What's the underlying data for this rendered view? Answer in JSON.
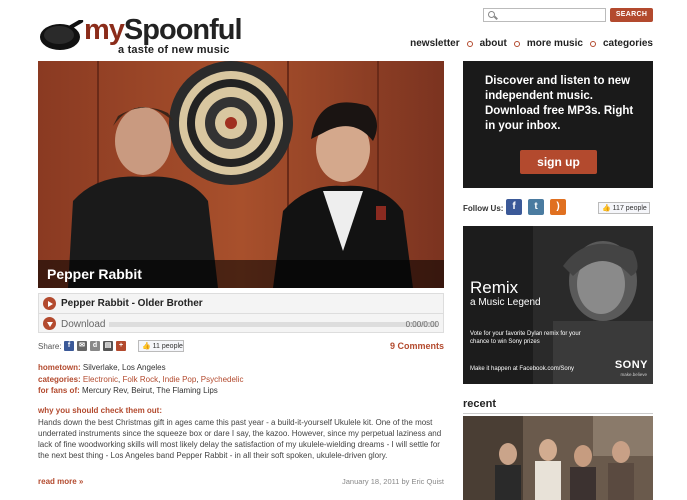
{
  "brand": {
    "name_part1": "my",
    "name_part2": "Spoonful",
    "tagline": "a taste of new music"
  },
  "search": {
    "placeholder": "",
    "button_label": "SEARCH"
  },
  "nav": {
    "items": [
      "newsletter",
      "about",
      "more music",
      "categories"
    ]
  },
  "hero": {
    "title": "Pepper Rabbit"
  },
  "player": {
    "track_title": "Pepper Rabbit - Older Brother",
    "download_label": "Download",
    "time": "0:00/0:00",
    "progress_fraction": 0
  },
  "share": {
    "label": "Share:",
    "like_count": "11 people",
    "comments": "9 Comments"
  },
  "info": {
    "hometown_label": "hometown:",
    "hometown": "Silverlake, Los Angeles",
    "categories_label": "categories:",
    "categories": [
      "Electronic",
      "Folk Rock",
      "Indie Pop",
      "Psychedelic"
    ],
    "fans_label": "for fans of:",
    "fans": "Mercury Rev, Beirut, The Flaming Lips"
  },
  "article": {
    "why_title": "why you should check them out:",
    "body": "Hands down the best Christmas gift in ages came this past year - a build-it-yourself Ukulele kit. One of the most underrated instruments since the squeeze box or dare I say, the kazoo. However, since my perpetual laziness and lack of fine woodworking skills will most likely delay the satisfaction of my ukulele-wielding dreams - I will settle for the next best thing - Los Angeles band Pepper Rabbit - in all their soft spoken, ukulele-driven glory.",
    "read_more": "read more »",
    "date": "January 18, 2011 by Eric Quist"
  },
  "signup": {
    "text": "Discover and listen to new independent music. Download free MP3s. Right in your inbox.",
    "button_label": "sign up"
  },
  "follow": {
    "label": "Follow Us:",
    "like_count": "117 people"
  },
  "ad": {
    "title": "Remix",
    "subtitle": "a Music Legend",
    "copy": "Vote for your favorite Dylan remix for your chance to win Sony prizes",
    "cta": "Make it happen at Facebook.com/Sony",
    "brand": "SONY",
    "brand_tag": "make.believe"
  },
  "recent": {
    "label": "recent"
  },
  "colors": {
    "accent": "#b34a2e",
    "dark_panel": "#1a1a1a"
  }
}
